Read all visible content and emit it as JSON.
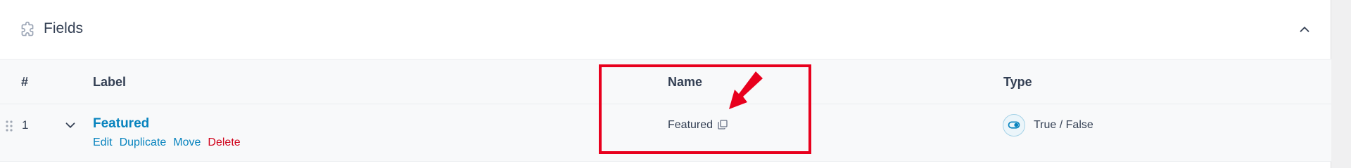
{
  "panel": {
    "title": "Fields",
    "icons": {
      "title": "puzzle-icon",
      "collapse": "chevron-up-icon"
    }
  },
  "table": {
    "columns": [
      "#",
      "Label",
      "Name",
      "Type"
    ],
    "rows": [
      {
        "order": "1",
        "label": "Featured",
        "actions": [
          "Edit",
          "Duplicate",
          "Move",
          "Delete"
        ],
        "name": "Featured",
        "type": "True / False"
      }
    ]
  },
  "annotation": {
    "color": "#e8001d",
    "target": "name-column"
  },
  "colors": {
    "link": "#0783be",
    "delete": "#d0021b",
    "text": "#344054"
  }
}
